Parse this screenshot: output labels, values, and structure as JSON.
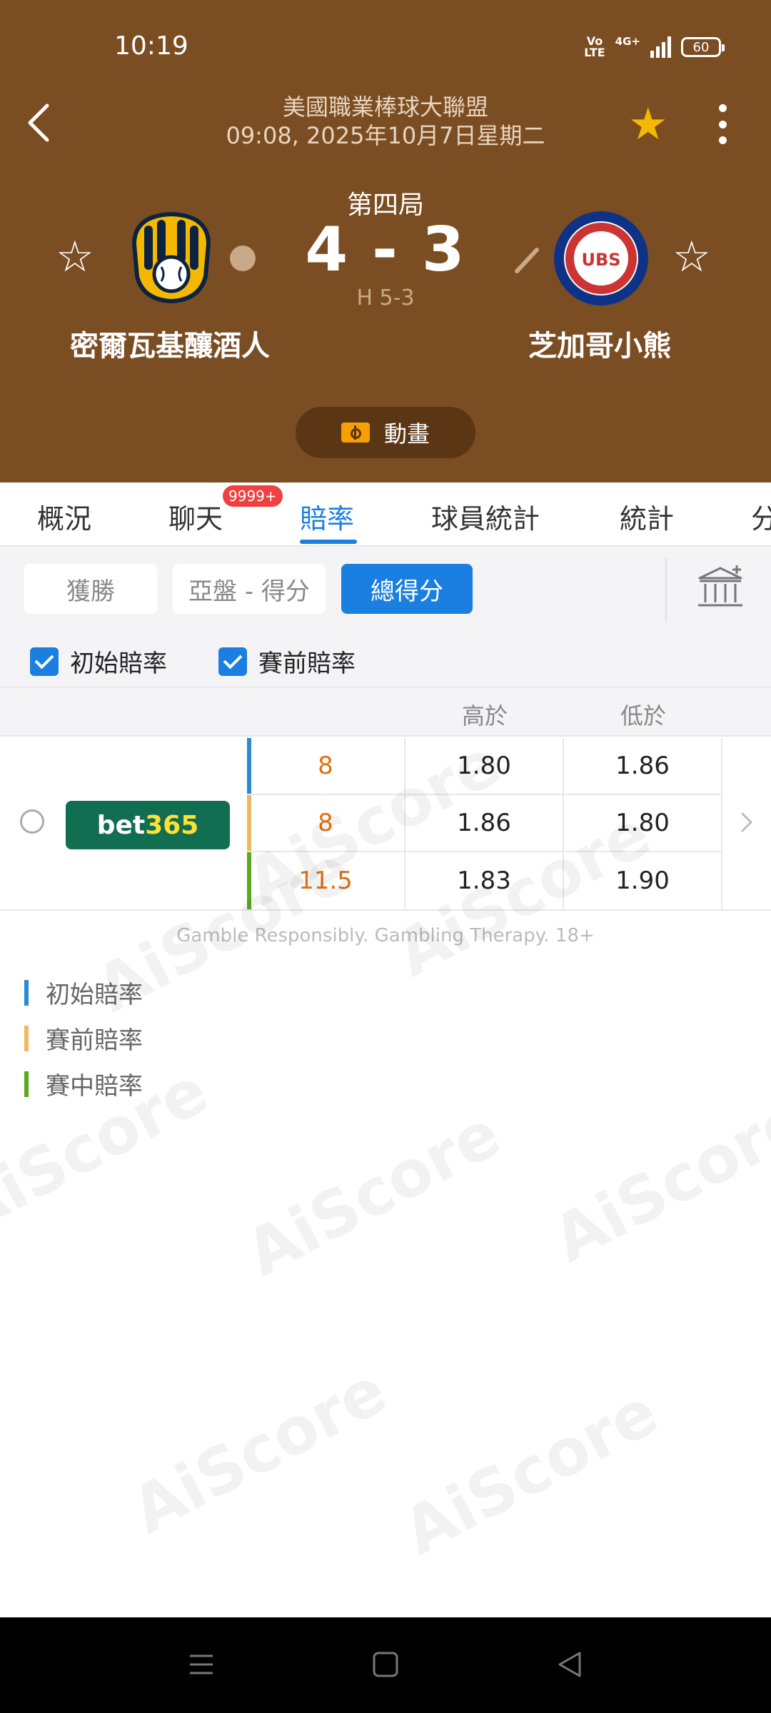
{
  "status_bar": {
    "time": "10:19",
    "volte": "Vo LTE",
    "network": "4G+",
    "battery": "60"
  },
  "header": {
    "league": "美國職業棒球大聯盟",
    "datetime": "09:08, 2025年10月7日星期二",
    "period": "第四局",
    "score": "4 - 3",
    "half_score": "H 5-3",
    "home_team": "密爾瓦基釀酒人",
    "away_team": "芝加哥小熊",
    "animation_label": "動畫",
    "favorite_color": "#f5b800",
    "background_color": "#7b4d22"
  },
  "tabs": {
    "items": [
      {
        "label": "概況"
      },
      {
        "label": "聊天"
      },
      {
        "label": "賠率"
      },
      {
        "label": "球員統計"
      },
      {
        "label": "統計"
      },
      {
        "label": "分"
      }
    ],
    "active_index": 2,
    "chat_badge": "9999+"
  },
  "filters": {
    "segments": [
      {
        "label": "獲勝"
      },
      {
        "label": "亞盤 - 得分"
      },
      {
        "label": "總得分"
      }
    ],
    "active_segment": 2,
    "checkboxes": [
      {
        "label": "初始賠率",
        "checked": true
      },
      {
        "label": "賽前賠率",
        "checked": true
      }
    ]
  },
  "odds": {
    "columns": [
      "高於",
      "低於"
    ],
    "bookmaker": {
      "part1": "bet",
      "part2": "365"
    },
    "rows": [
      {
        "line": "8",
        "over": "1.80",
        "under": "1.86",
        "color": "#2a8ad8"
      },
      {
        "line": "8",
        "over": "1.86",
        "under": "1.80",
        "color": "#f0b860"
      },
      {
        "line": "11.5",
        "over": "1.83",
        "under": "1.90",
        "color": "#5aaa1e"
      }
    ]
  },
  "disclaimer": "Gamble Responsibly. Gambling Therapy. 18+",
  "legend": [
    {
      "label": "初始賠率",
      "color": "#2a8ad8"
    },
    {
      "label": "賽前賠率",
      "color": "#f0b860"
    },
    {
      "label": "賽中賠率",
      "color": "#5aaa1e"
    }
  ],
  "watermark": "AiScore"
}
